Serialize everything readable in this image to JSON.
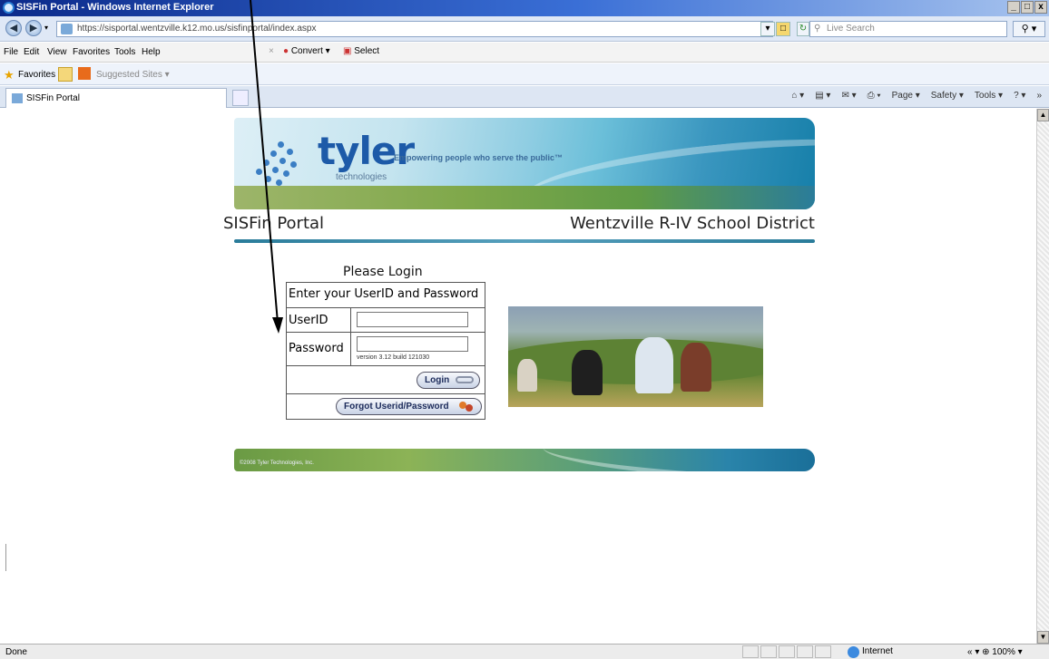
{
  "window": {
    "title": "SISFin Portal - Windows Internet Explorer",
    "buttons": [
      "_",
      "□",
      "x"
    ]
  },
  "address_bar": {
    "url": "https://sisportal.wentzville.k12.mo.us/sisfinportal/index.aspx",
    "search_placeholder": "Live Search"
  },
  "menu": {
    "items": [
      "File",
      "Edit",
      "View",
      "Favorites",
      "Tools",
      "Help"
    ],
    "toolbar": [
      "Convert ▾",
      "Select"
    ]
  },
  "favorites_bar": {
    "favorites_label": "Favorites",
    "suggested_label": "Suggested Sites ▾"
  },
  "tabs": {
    "active_label": "SISFin Portal"
  },
  "command_bar": {
    "items": [
      "⌂ ▾",
      "▤ ▾",
      "✉ ▾",
      "⎙ ▾",
      "Page ▾",
      "Safety ▾",
      "Tools ▾",
      "? ▾",
      "»"
    ]
  },
  "banner": {
    "logo_text": "tyler",
    "logo_subtext": "technologies",
    "tagline": "Empowering people who serve the public™"
  },
  "page": {
    "portal_title": "SISFin Portal",
    "district_name": "Wentzville R-IV School District"
  },
  "login": {
    "heading": "Please Login",
    "instructions": "Enter your UserID and Password",
    "userid_label": "UserID",
    "userid_value": "",
    "password_label": "Password",
    "password_value": "",
    "version_text": "version 3.12    build 121030",
    "login_button": "Login",
    "forgot_button": "Forgot Userid/Password"
  },
  "footer": {
    "copyright": "©2008 Tyler Technologies, Inc."
  },
  "status_bar": {
    "status": "Done",
    "zone": "Internet",
    "zoom": "« ▾  ⊕ 100%  ▾"
  },
  "colors": {
    "accent_blue": "#1d5aa8",
    "rule_teal": "#2a7c9a",
    "title_bar": "#0b2a8a"
  }
}
